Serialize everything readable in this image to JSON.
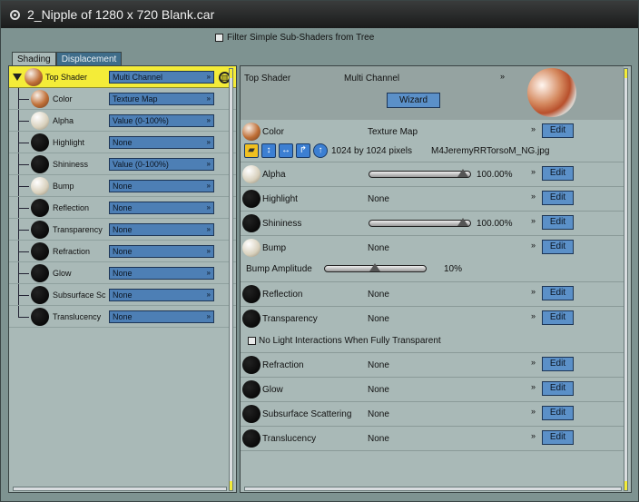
{
  "window": {
    "title": "2_Nipple of 1280 x 720 Blank.car"
  },
  "filter": {
    "label": "Filter Simple Sub-Shaders from Tree"
  },
  "tabs": [
    {
      "label": "Shading",
      "active": true
    },
    {
      "label": "Displacement",
      "active": false
    }
  ],
  "tree": {
    "top": {
      "label": "Top Shader",
      "value": "Multi Channel"
    },
    "items": [
      {
        "label": "Color",
        "value": "Texture Map",
        "ball": "color"
      },
      {
        "label": "Alpha",
        "value": "Value (0-100%)",
        "ball": "white"
      },
      {
        "label": "Highlight",
        "value": "None",
        "ball": "black"
      },
      {
        "label": "Shininess",
        "value": "Value (0-100%)",
        "ball": "black"
      },
      {
        "label": "Bump",
        "value": "None",
        "ball": "white"
      },
      {
        "label": "Reflection",
        "value": "None",
        "ball": "black"
      },
      {
        "label": "Transparency",
        "value": "None",
        "ball": "black"
      },
      {
        "label": "Refraction",
        "value": "None",
        "ball": "black"
      },
      {
        "label": "Glow",
        "value": "None",
        "ball": "black"
      },
      {
        "label": "Subsurface Sc",
        "value": "None",
        "ball": "black"
      },
      {
        "label": "Translucency",
        "value": "None",
        "ball": "black"
      }
    ]
  },
  "right": {
    "header": {
      "name": "Top Shader",
      "value": "Multi Channel",
      "wizard": "Wizard"
    },
    "color": {
      "name": "Color",
      "value": "Texture Map",
      "edit": "Edit",
      "size_text": "1024 by 1024 pixels",
      "file": "M4JeremyRRTorsoM_NG.jpg"
    },
    "alpha": {
      "name": "Alpha",
      "percent_text": "100.00%",
      "level": 1.0,
      "edit": "Edit"
    },
    "highlight": {
      "name": "Highlight",
      "value": "None",
      "edit": "Edit"
    },
    "shininess": {
      "name": "Shininess",
      "percent_text": "100.00%",
      "level": 1.0,
      "edit": "Edit"
    },
    "bump": {
      "name": "Bump",
      "value": "None",
      "edit": "Edit"
    },
    "bump_amp": {
      "label": "Bump Amplitude",
      "percent_text": "10%",
      "level": 0.5
    },
    "reflection": {
      "name": "Reflection",
      "value": "None",
      "edit": "Edit"
    },
    "transparency": {
      "name": "Transparency",
      "value": "None",
      "edit": "Edit"
    },
    "nolight": {
      "label": "No Light Interactions When Fully Transparent"
    },
    "refraction": {
      "name": "Refraction",
      "value": "None",
      "edit": "Edit"
    },
    "glow": {
      "name": "Glow",
      "value": "None",
      "edit": "Edit"
    },
    "subsurface": {
      "name": "Subsurface Scattering",
      "value": "None",
      "edit": "Edit"
    },
    "translucency": {
      "name": "Translucency",
      "value": "None",
      "edit": "Edit"
    }
  }
}
